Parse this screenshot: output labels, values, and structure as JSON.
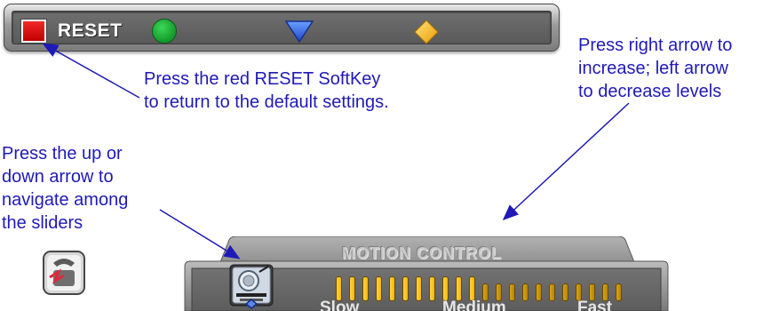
{
  "softkeys": {
    "reset_label": "RESET",
    "red_color": "#e01818",
    "green_color": "#1fb53a",
    "blue_color": "#2d5fe0",
    "yellow_color": "#f6b800"
  },
  "annotations": {
    "reset": "Press the red RESET SoftKey\nto return to the default settings.",
    "arrows": "Press right arrow to\nincrease; left arrow\nto decrease levels",
    "navigate": "Press the up or\ndown arrow to\nnavigate among\nthe sliders"
  },
  "motion_control": {
    "title": "MOTION CONTROL",
    "slider_labels": [
      "Slow",
      "Medium",
      "Fast"
    ],
    "total_steps": 22,
    "level": 11,
    "active_color": "#f6b800",
    "inactive_color": "#b88600"
  },
  "icons": {
    "slider_icon": "camera-icon",
    "nav_icon": "telephone-icon"
  }
}
